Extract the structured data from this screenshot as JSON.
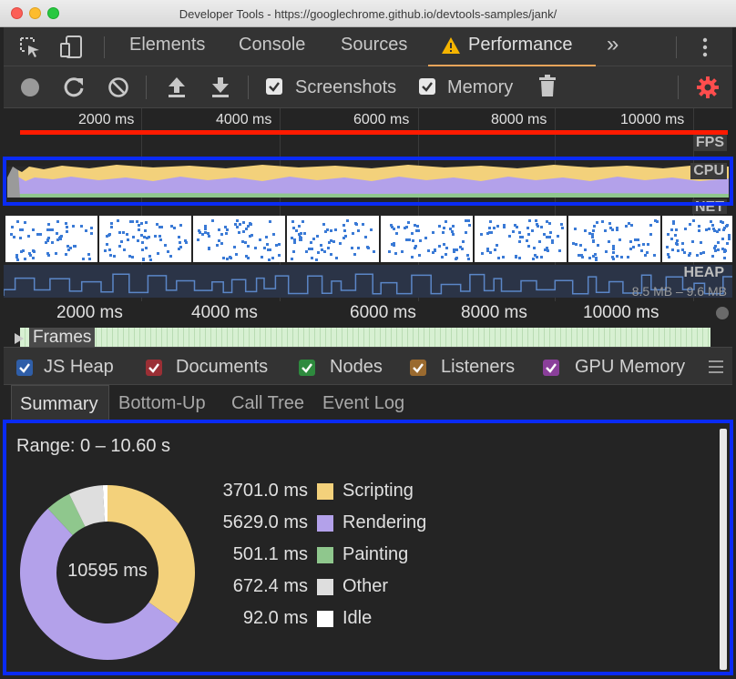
{
  "window": {
    "title": "Developer Tools - https://googlechrome.github.io/devtools-samples/jank/"
  },
  "tabs": {
    "elements": "Elements",
    "console": "Console",
    "sources": "Sources",
    "performance": "Performance",
    "more": "»"
  },
  "toolbar": {
    "screenshots_label": "Screenshots",
    "screenshots_checked": true,
    "memory_label": "Memory",
    "memory_checked": true
  },
  "overview": {
    "ruler": [
      "2000 ms",
      "4000 ms",
      "6000 ms",
      "8000 ms",
      "10000 ms"
    ],
    "fps_label": "FPS",
    "cpu_label": "CPU",
    "net_label": "NET",
    "heap_label": "HEAP",
    "heap_range": "8.5 MB – 9.6 MB"
  },
  "timeline": {
    "ruler": [
      "2000 ms",
      "4000 ms",
      "6000 ms",
      "8000 ms",
      "10000 ms"
    ],
    "frames_label": "Frames"
  },
  "memory_legend": [
    {
      "label": "JS Heap",
      "color": "#2f5ea8"
    },
    {
      "label": "Documents",
      "color": "#9b2f35"
    },
    {
      "label": "Nodes",
      "color": "#2e8a3e"
    },
    {
      "label": "Listeners",
      "color": "#9a6a2f"
    },
    {
      "label": "GPU Memory",
      "color": "#8a3f9a"
    }
  ],
  "details_tabs": [
    "Summary",
    "Bottom-Up",
    "Call Tree",
    "Event Log"
  ],
  "summary": {
    "range": "Range: 0 – 10.60 s",
    "total": "10595 ms",
    "rows": [
      {
        "value": "3701.0 ms",
        "name": "Scripting",
        "color": "#f3d17b",
        "ms": 3701.0
      },
      {
        "value": "5629.0 ms",
        "name": "Rendering",
        "color": "#b3a1ea",
        "ms": 5629.0
      },
      {
        "value": "501.1 ms",
        "name": "Painting",
        "color": "#8fc78d",
        "ms": 501.1
      },
      {
        "value": "672.4 ms",
        "name": "Other",
        "color": "#dedede",
        "ms": 672.4
      },
      {
        "value": "92.0 ms",
        "name": "Idle",
        "color": "#ffffff",
        "ms": 92.0
      }
    ]
  },
  "colors": {
    "highlight": "#0a2bf5",
    "fps_bar": "#ff1a00",
    "warning": "#f5b400",
    "settings": "#ff4d4d"
  }
}
